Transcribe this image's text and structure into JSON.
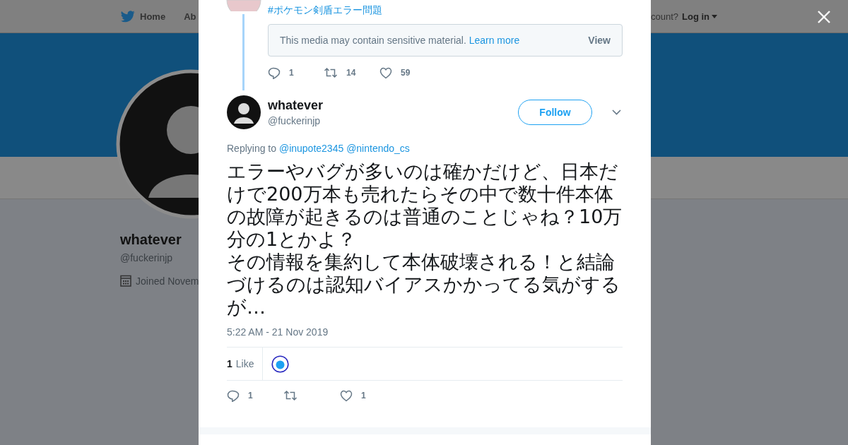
{
  "background_page": {
    "nav": [
      {
        "kind": "home",
        "label": "Home"
      },
      {
        "kind": "text",
        "label": "Ab"
      }
    ],
    "login_prompt": "count?",
    "login": "Log in",
    "profile": {
      "name": "whatever",
      "handle": "@fuckerinjp",
      "joined": "Joined Novem"
    }
  },
  "parent_tweet": {
    "hashtag": "#ポケモン剣盾エラー問題",
    "sensitive": {
      "message": "This media may contain sensitive material.",
      "link": "Learn more",
      "button": "View"
    },
    "actions": [
      {
        "kind": "reply",
        "count": "1"
      },
      {
        "kind": "retweet",
        "count": "14"
      },
      {
        "kind": "like",
        "count": "59"
      }
    ]
  },
  "tweet": {
    "name": "whatever",
    "handle": "@fuckerinjp",
    "follow": "Follow",
    "replying_label": "Replying to",
    "mentions": [
      "@inupote2345",
      "@nintendo_cs"
    ],
    "text": [
      "エラーやバグが多いのは確かだけど、日本だけで200万本も売れたらその中で数十件本体の故障が起きるのは普通のことじゃね？10万分の1とかよ？",
      "その情報を集約して本体破壊される！と結論づけるのは認知バイアスかかってる気がするが…"
    ],
    "time": "5:22 AM - 21 Nov 2019",
    "likes_count": "1",
    "likes_label": "Like",
    "actions": [
      {
        "kind": "reply",
        "count": "1"
      },
      {
        "kind": "retweet"
      },
      {
        "kind": "like",
        "count": "1"
      }
    ]
  }
}
